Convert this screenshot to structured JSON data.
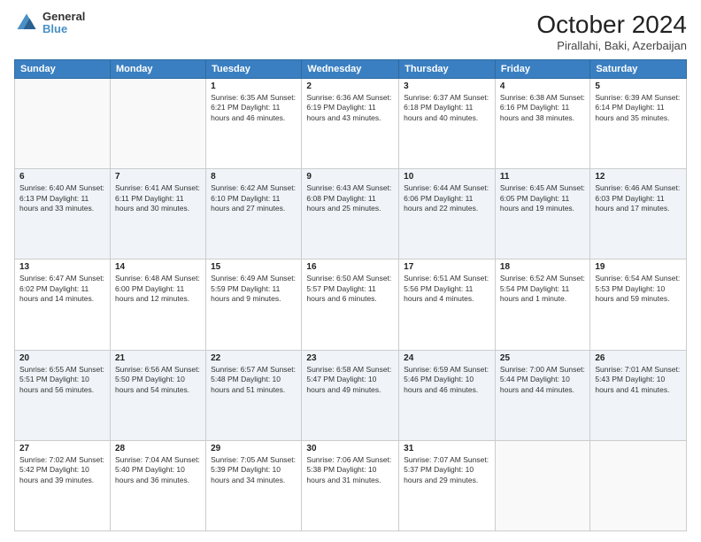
{
  "logo": {
    "general": "General",
    "blue": "Blue"
  },
  "header": {
    "month": "October 2024",
    "location": "Pirallahi, Baki, Azerbaijan"
  },
  "weekdays": [
    "Sunday",
    "Monday",
    "Tuesday",
    "Wednesday",
    "Thursday",
    "Friday",
    "Saturday"
  ],
  "weeks": [
    [
      {
        "day": "",
        "info": ""
      },
      {
        "day": "",
        "info": ""
      },
      {
        "day": "1",
        "info": "Sunrise: 6:35 AM\nSunset: 6:21 PM\nDaylight: 11 hours and 46 minutes."
      },
      {
        "day": "2",
        "info": "Sunrise: 6:36 AM\nSunset: 6:19 PM\nDaylight: 11 hours and 43 minutes."
      },
      {
        "day": "3",
        "info": "Sunrise: 6:37 AM\nSunset: 6:18 PM\nDaylight: 11 hours and 40 minutes."
      },
      {
        "day": "4",
        "info": "Sunrise: 6:38 AM\nSunset: 6:16 PM\nDaylight: 11 hours and 38 minutes."
      },
      {
        "day": "5",
        "info": "Sunrise: 6:39 AM\nSunset: 6:14 PM\nDaylight: 11 hours and 35 minutes."
      }
    ],
    [
      {
        "day": "6",
        "info": "Sunrise: 6:40 AM\nSunset: 6:13 PM\nDaylight: 11 hours and 33 minutes."
      },
      {
        "day": "7",
        "info": "Sunrise: 6:41 AM\nSunset: 6:11 PM\nDaylight: 11 hours and 30 minutes."
      },
      {
        "day": "8",
        "info": "Sunrise: 6:42 AM\nSunset: 6:10 PM\nDaylight: 11 hours and 27 minutes."
      },
      {
        "day": "9",
        "info": "Sunrise: 6:43 AM\nSunset: 6:08 PM\nDaylight: 11 hours and 25 minutes."
      },
      {
        "day": "10",
        "info": "Sunrise: 6:44 AM\nSunset: 6:06 PM\nDaylight: 11 hours and 22 minutes."
      },
      {
        "day": "11",
        "info": "Sunrise: 6:45 AM\nSunset: 6:05 PM\nDaylight: 11 hours and 19 minutes."
      },
      {
        "day": "12",
        "info": "Sunrise: 6:46 AM\nSunset: 6:03 PM\nDaylight: 11 hours and 17 minutes."
      }
    ],
    [
      {
        "day": "13",
        "info": "Sunrise: 6:47 AM\nSunset: 6:02 PM\nDaylight: 11 hours and 14 minutes."
      },
      {
        "day": "14",
        "info": "Sunrise: 6:48 AM\nSunset: 6:00 PM\nDaylight: 11 hours and 12 minutes."
      },
      {
        "day": "15",
        "info": "Sunrise: 6:49 AM\nSunset: 5:59 PM\nDaylight: 11 hours and 9 minutes."
      },
      {
        "day": "16",
        "info": "Sunrise: 6:50 AM\nSunset: 5:57 PM\nDaylight: 11 hours and 6 minutes."
      },
      {
        "day": "17",
        "info": "Sunrise: 6:51 AM\nSunset: 5:56 PM\nDaylight: 11 hours and 4 minutes."
      },
      {
        "day": "18",
        "info": "Sunrise: 6:52 AM\nSunset: 5:54 PM\nDaylight: 11 hours and 1 minute."
      },
      {
        "day": "19",
        "info": "Sunrise: 6:54 AM\nSunset: 5:53 PM\nDaylight: 10 hours and 59 minutes."
      }
    ],
    [
      {
        "day": "20",
        "info": "Sunrise: 6:55 AM\nSunset: 5:51 PM\nDaylight: 10 hours and 56 minutes."
      },
      {
        "day": "21",
        "info": "Sunrise: 6:56 AM\nSunset: 5:50 PM\nDaylight: 10 hours and 54 minutes."
      },
      {
        "day": "22",
        "info": "Sunrise: 6:57 AM\nSunset: 5:48 PM\nDaylight: 10 hours and 51 minutes."
      },
      {
        "day": "23",
        "info": "Sunrise: 6:58 AM\nSunset: 5:47 PM\nDaylight: 10 hours and 49 minutes."
      },
      {
        "day": "24",
        "info": "Sunrise: 6:59 AM\nSunset: 5:46 PM\nDaylight: 10 hours and 46 minutes."
      },
      {
        "day": "25",
        "info": "Sunrise: 7:00 AM\nSunset: 5:44 PM\nDaylight: 10 hours and 44 minutes."
      },
      {
        "day": "26",
        "info": "Sunrise: 7:01 AM\nSunset: 5:43 PM\nDaylight: 10 hours and 41 minutes."
      }
    ],
    [
      {
        "day": "27",
        "info": "Sunrise: 7:02 AM\nSunset: 5:42 PM\nDaylight: 10 hours and 39 minutes."
      },
      {
        "day": "28",
        "info": "Sunrise: 7:04 AM\nSunset: 5:40 PM\nDaylight: 10 hours and 36 minutes."
      },
      {
        "day": "29",
        "info": "Sunrise: 7:05 AM\nSunset: 5:39 PM\nDaylight: 10 hours and 34 minutes."
      },
      {
        "day": "30",
        "info": "Sunrise: 7:06 AM\nSunset: 5:38 PM\nDaylight: 10 hours and 31 minutes."
      },
      {
        "day": "31",
        "info": "Sunrise: 7:07 AM\nSunset: 5:37 PM\nDaylight: 10 hours and 29 minutes."
      },
      {
        "day": "",
        "info": ""
      },
      {
        "day": "",
        "info": ""
      }
    ]
  ]
}
